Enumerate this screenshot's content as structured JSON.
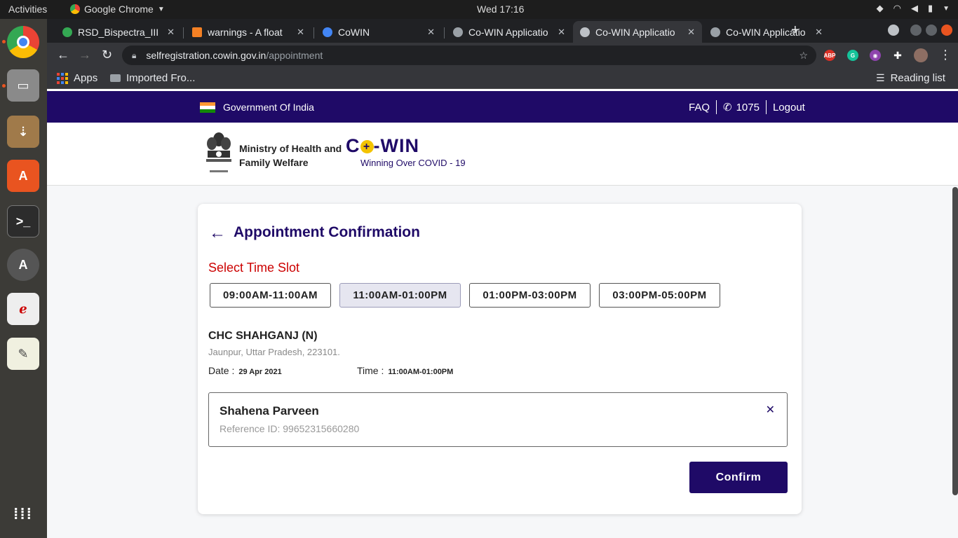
{
  "system": {
    "activities": "Activities",
    "app_name": "Google Chrome",
    "clock": "Wed 17:16"
  },
  "browser": {
    "tabs": [
      {
        "title": "RSD_Bispectra_III",
        "active": false
      },
      {
        "title": "warnings - A float",
        "active": false
      },
      {
        "title": "CoWIN",
        "active": false
      },
      {
        "title": "Co-WIN Applicatio",
        "active": false
      },
      {
        "title": "Co-WIN Applicatio",
        "active": true
      },
      {
        "title": "Co-WIN Applicatio",
        "active": false
      }
    ],
    "url_domain": "selfregistration.cowin.gov.in",
    "url_path": "/appointment",
    "bookmarks": {
      "apps": "Apps",
      "imported": "Imported Fro...",
      "reading_list": "Reading list"
    }
  },
  "site": {
    "gov_label": "Government Of India",
    "faq": "FAQ",
    "helpline": "1075",
    "logout": "Logout",
    "ministry_line1": "Ministry of Health and",
    "ministry_line2": "Family Welfare",
    "logo_prefix": "C",
    "logo_plus": "+",
    "logo_suffix": "-WIN",
    "tagline": "Winning Over COVID - 19"
  },
  "appointment": {
    "title": "Appointment Confirmation",
    "slot_label": "Select Time Slot",
    "slots": [
      {
        "label": "09:00AM-11:00AM",
        "selected": false
      },
      {
        "label": "11:00AM-01:00PM",
        "selected": true
      },
      {
        "label": "01:00PM-03:00PM",
        "selected": false
      },
      {
        "label": "03:00PM-05:00PM",
        "selected": false
      }
    ],
    "center_name": "CHC SHAHGANJ (N)",
    "center_address": "Jaunpur, Uttar Pradesh, 223101.",
    "date_label": "Date :",
    "date_value": "29 Apr 2021",
    "time_label": "Time :",
    "time_value": "11:00AM-01:00PM",
    "beneficiary_name": "Shahena Parveen",
    "reference": "Reference ID: 99652315660280",
    "confirm_label": "Confirm"
  },
  "colors": {
    "brand": "#1f0a67",
    "accent_red": "#cc0000",
    "dock": "#3c3b37"
  }
}
